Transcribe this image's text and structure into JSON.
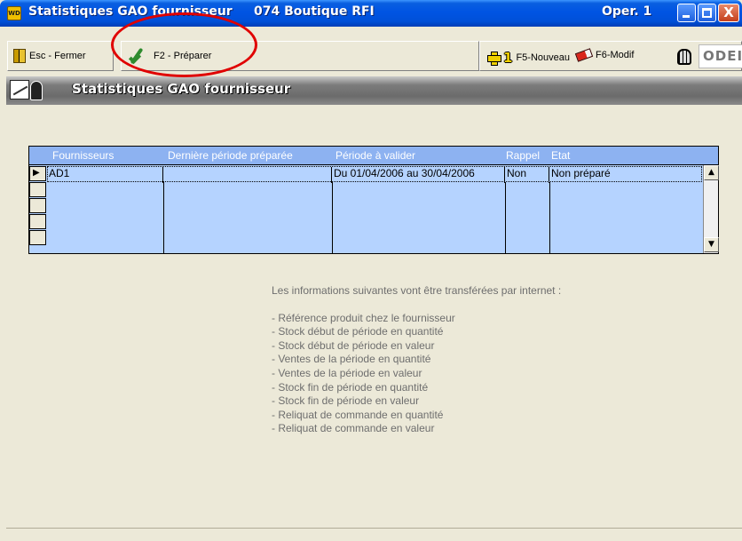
{
  "window": {
    "title": "Statistiques GAO fournisseur",
    "store": "074 Boutique RFI",
    "operator": "Oper. 1",
    "app_icon_text": "WD",
    "controls": {
      "close_glyph": "X"
    }
  },
  "toolbar": {
    "esc_label": "Esc - Fermer",
    "prepare_label": "F2 - Préparer",
    "new_label": "F5-Nouveau",
    "new_key_digit": "1",
    "modify_label": "F6-Modif",
    "logo_text": "ODEIS"
  },
  "header": {
    "title": "Statistiques GAO fournisseur"
  },
  "grid": {
    "columns": [
      "Fournisseurs",
      "Dernière période préparée",
      "Période à valider",
      "Rappel",
      "Etat"
    ],
    "rows": [
      {
        "fournisseur": "AD1",
        "derniere": "",
        "periode": "Du 01/04/2006 au 30/04/2006",
        "rappel": "Non",
        "etat": "Non préparé"
      }
    ],
    "scroll_up": "▲",
    "scroll_down": "▼"
  },
  "info": {
    "intro": "Les informations suivantes vont être transférées par internet :",
    "items": [
      "- Référence produit chez le fournisseur",
      "- Stock début de période en quantité",
      "- Stock début de période en valeur",
      "- Ventes de la période en quantité",
      "- Ventes de la période en valeur",
      "- Stock fin de période en quantité",
      "- Stock fin de période en valeur",
      "- Reliquat de commande en quantité",
      "- Reliquat de commande en valeur"
    ]
  },
  "colors": {
    "titlebar": "#0054E3",
    "grid_fill": "#B5D3FF",
    "grid_header": "#8DB2F1",
    "annotation": "#E00000"
  },
  "icons": [
    "app-icon",
    "exit-icon",
    "check-icon",
    "plus-icon",
    "eraser-icon",
    "trash-icon",
    "chart-icon",
    "person-icon"
  ]
}
